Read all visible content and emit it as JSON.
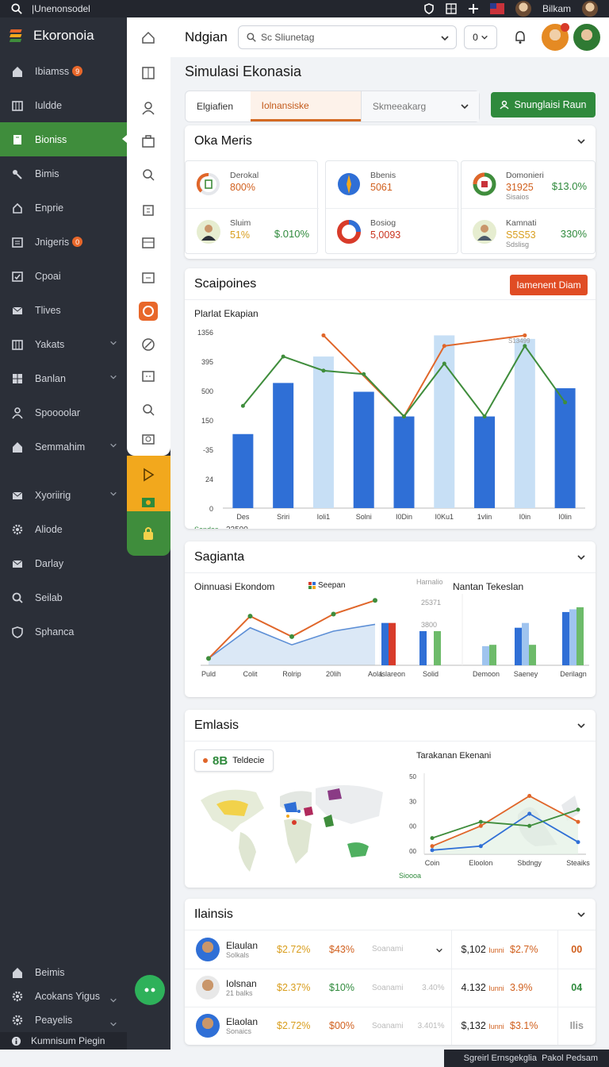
{
  "topbar": {
    "title": "|Unenonsodel",
    "user": "Bilkam"
  },
  "brand": {
    "name": "Ekoronoia"
  },
  "nav": {
    "items": [
      {
        "label": "Ibiamss",
        "badge": "9",
        "icon": "home-icon"
      },
      {
        "label": "Iuldde",
        "icon": "columns-icon"
      },
      {
        "label": "Bioniss",
        "icon": "document-icon",
        "active": true
      },
      {
        "label": "Bimis",
        "icon": "key-icon"
      },
      {
        "label": "Enprie",
        "icon": "upload-icon"
      },
      {
        "label": "Jnigeris",
        "badge": "0",
        "icon": "list-icon"
      },
      {
        "label": "Cpoai",
        "icon": "check-icon"
      },
      {
        "label": "Tlives",
        "icon": "mail-icon"
      },
      {
        "label": "Yakats",
        "icon": "columns-icon",
        "chevron": true
      },
      {
        "label": "Banlan",
        "icon": "grid-icon",
        "chevron": true
      },
      {
        "label": "Spoooolar",
        "icon": "person-icon"
      },
      {
        "label": "Semmahim",
        "icon": "home-icon",
        "chevron": true
      }
    ],
    "items2": [
      {
        "label": "Xyoriirig",
        "icon": "mail-icon",
        "chevron": true
      },
      {
        "label": "Aliode",
        "icon": "gear-icon"
      },
      {
        "label": "Darlay",
        "icon": "mail-icon"
      },
      {
        "label": "Seilab",
        "icon": "search-icon"
      },
      {
        "label": "Sphanca",
        "icon": "shield-icon"
      }
    ],
    "bottom": [
      {
        "label": "Beimis",
        "icon": "home-icon"
      },
      {
        "label": "Acokans Yigus",
        "icon": "gear-icon",
        "chevron": true
      },
      {
        "label": "Peayelis",
        "icon": "gear-icon",
        "chevron": true
      }
    ],
    "footer": "Kumnisum Piegin"
  },
  "header": {
    "title": "Ndgian",
    "search_placeholder": "Sc Sliunetag",
    "select_value": "0"
  },
  "page": {
    "subtitle": "Simulasi Ekonasia"
  },
  "tabs": {
    "items": [
      "Elgiafien",
      "Iolnansiske"
    ],
    "dropdown": "Skmeeakarg",
    "cta": "Snunglaisi Raun"
  },
  "metrics_card": {
    "title": "Oka Meris",
    "metrics": [
      {
        "label": "Derokal",
        "value": "800%"
      },
      {
        "label": "Sluim",
        "value": "51%",
        "right": "$.010%"
      },
      {
        "label": "Bbenis",
        "value": "5061"
      },
      {
        "label": "Bosiog",
        "value": "5,0093"
      },
      {
        "label": "Domonieri",
        "value": "31925",
        "sub": "Sisaios",
        "right": "$13.0%"
      },
      {
        "label": "Kamnati",
        "value": "S5S53",
        "sub": "Sdslisg",
        "right": "330%"
      }
    ]
  },
  "scenario_card": {
    "title": "Scaipoines",
    "button": "Iamenent Diam",
    "chart_title": "Plarlat Ekapian",
    "footer_label": "Sandas",
    "footer_value": "23500",
    "peak_label": "S13499"
  },
  "sag_card": {
    "title": "Sagianta",
    "left_title": "Oinnuasi Ekondom",
    "legend_label": "Seepan",
    "right_title": "Nantan Tekeslan",
    "mid_label": "Harnalio",
    "mid_value1": "25371",
    "mid_value2": "3800"
  },
  "map_card": {
    "title": "Emlasis",
    "badge_value": "8B",
    "badge_label": "Teldecie",
    "line_title": "Tarakanan Ekenani",
    "x_footer": "Sioooa"
  },
  "table_card": {
    "title": "Ilainsis",
    "rows": [
      {
        "name": "Elaulan",
        "sub": "Solkals",
        "v1": "$2.72%",
        "v2": "$43%",
        "v3": "Soanami",
        "v4": "$,102",
        "v5": "Iunni",
        "v6": "$2.7%",
        "v7": "00"
      },
      {
        "name": "Iolsnan",
        "sub": "21 balks",
        "v1": "$2.37%",
        "v2": "$10%",
        "v3": "Soanami",
        "v3b": "3.40%",
        "v4": "4.132",
        "v5": "Iunni",
        "v6": "3.9%",
        "v7": "04"
      },
      {
        "name": "Elaolan",
        "sub": "Sonaics",
        "v1": "$2.72%",
        "v2": "$00%",
        "v3": "Soanami",
        "v3b": "3.401%",
        "v4": "$,132",
        "v5": "Iunni",
        "v6": "$3.1%",
        "v7": "Ilis"
      }
    ]
  },
  "chart_data": [
    {
      "type": "bar",
      "title": "Plarlat Ekapian",
      "ylabel": "",
      "y_tick_labels": [
        "1356",
        "395",
        "500",
        "150",
        "-35",
        "24",
        "0"
      ],
      "categories": [
        "Des",
        "Sriri",
        "Ioli1",
        "Solni",
        "I0Din",
        "I0Ku1",
        "1vlin",
        "I0in",
        "I0lin"
      ],
      "series": [
        {
          "values": [
            0.42,
            0.71,
            0.0,
            0.66,
            0.52,
            0.0,
            0.52,
            0.0,
            0.68
          ]
        },
        {
          "values": [
            0.0,
            0.0,
            0.86,
            0.0,
            0.0,
            0.98,
            0.0,
            0.96,
            0.0
          ]
        },
        {
          "values": [
            0.58,
            0.86,
            0.78,
            0.76,
            0.52,
            0.82,
            0.52,
            0.92,
            0.6
          ]
        },
        {
          "values": [
            0.0,
            0.0,
            0.98,
            0.0,
            0.52,
            0.92,
            0.0,
            0.98,
            0.0
          ]
        }
      ],
      "ylim": [
        0,
        1
      ]
    },
    {
      "type": "line",
      "title": "Oinnuasi Ekondom",
      "categories": [
        "Puld",
        "Colit",
        "Rolrip",
        "20lih",
        "Aola"
      ],
      "series": [
        {
          "values": [
            0.1,
            0.72,
            0.42,
            0.75,
            0.95
          ]
        },
        {
          "values": [
            0.1,
            0.55,
            0.3,
            0.5,
            0.6
          ]
        }
      ]
    },
    {
      "type": "bar",
      "title": "Nantan Tekeslan",
      "categories": [
        "Islareon",
        "Solid",
        "Demoon",
        "Saeney",
        "Derilagn"
      ],
      "series": [
        {
          "name": "Seepan",
          "values": [
            0.62,
            0.5,
            0.0,
            0.55,
            0.78
          ]
        },
        {
          "values": [
            0.62,
            0.0,
            0.28,
            0.62,
            0.82
          ]
        },
        {
          "values": [
            0.0,
            0.5,
            0.3,
            0.3,
            0.85
          ]
        }
      ]
    },
    {
      "type": "line",
      "title": "Tarakanan Ekenani",
      "y_tick_labels": [
        "50",
        "30",
        "00",
        "00"
      ],
      "categories": [
        "Coin",
        "Eloolon",
        "Sbdngy",
        "Steaiks"
      ],
      "series": [
        {
          "values": [
            0.1,
            0.35,
            0.72,
            0.4
          ]
        },
        {
          "values": [
            0.05,
            0.1,
            0.5,
            0.15
          ]
        },
        {
          "values": [
            0.2,
            0.4,
            0.35,
            0.55
          ]
        }
      ]
    }
  ],
  "colors": {
    "sidebar": "#2b2f38",
    "active": "#3f8d3c",
    "accent_orange": "#d46a23",
    "bar_dark": "#2f6fd6",
    "bar_light": "#c7dff5",
    "line_green": "#3f8d3c",
    "line_orange": "#e0662a"
  }
}
